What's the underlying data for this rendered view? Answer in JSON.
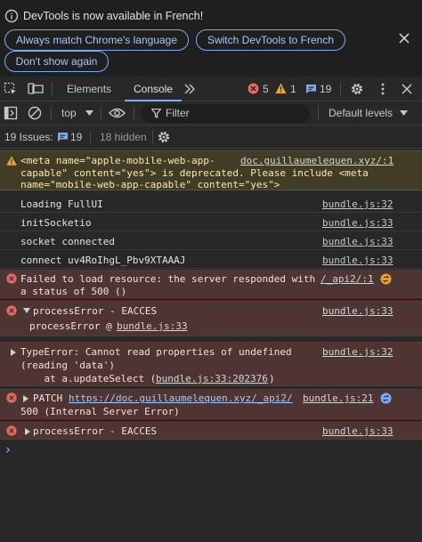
{
  "infobar": {
    "text": "DevTools is now available in French!",
    "buttons": [
      "Always match Chrome's language",
      "Switch DevTools to French",
      "Don't show again"
    ]
  },
  "tabs": {
    "elements": "Elements",
    "console": "Console"
  },
  "counts": {
    "errors": "5",
    "warnings": "1",
    "issues": "19"
  },
  "console_toolbar": {
    "context": "top",
    "filter_placeholder": "Filter",
    "levels": "Default levels"
  },
  "issues_bar": {
    "label": "19 Issues:",
    "count": "19",
    "hidden": "18 hidden"
  },
  "messages": {
    "warn": {
      "line1": "<meta name=\"apple-mobile-web-app-",
      "line2": "capable\" content=\"yes\"> is deprecated. Please include <meta",
      "line3": "name=\"mobile-web-app-capable\" content=\"yes\">",
      "source": "doc.guillaumelequen.xyz/:1"
    },
    "log1": {
      "text": "Loading FullUI",
      "source": "bundle.js:32"
    },
    "log2": {
      "text": "initSocketio",
      "source": "bundle.js:33"
    },
    "log3": {
      "text": "socket connected",
      "source": "bundle.js:33"
    },
    "log4": {
      "text": "connect uv4RoIhgL_Pbv9XTAAAJ",
      "source": "bundle.js:33"
    },
    "err1": {
      "line1": "Failed to load resource: the server responded with",
      "source": "/_api2/:1",
      "line2": "a status of 500 ()"
    },
    "err2": {
      "line1": "processError - EACCES",
      "source": "bundle.js:33",
      "line2_prefix": "processError @ ",
      "line2_link": "bundle.js:33"
    },
    "err3": {
      "line1": "TypeError: Cannot read properties of undefined",
      "source": "bundle.js:32",
      "line2": "(reading 'data')",
      "line3_prefix": "    at a.updateSelect (",
      "line3_link": "bundle.js:33:202376",
      "line3_suffix": ")"
    },
    "err4": {
      "method": "PATCH",
      "url": "https://doc.guillaumelequen.xyz/_api2/",
      "source": "bundle.js:21",
      "line2": "500 (Internal Server Error)"
    },
    "err5": {
      "line1": "processError - EACCES",
      "source": "bundle.js:33"
    }
  },
  "prompt": "›"
}
